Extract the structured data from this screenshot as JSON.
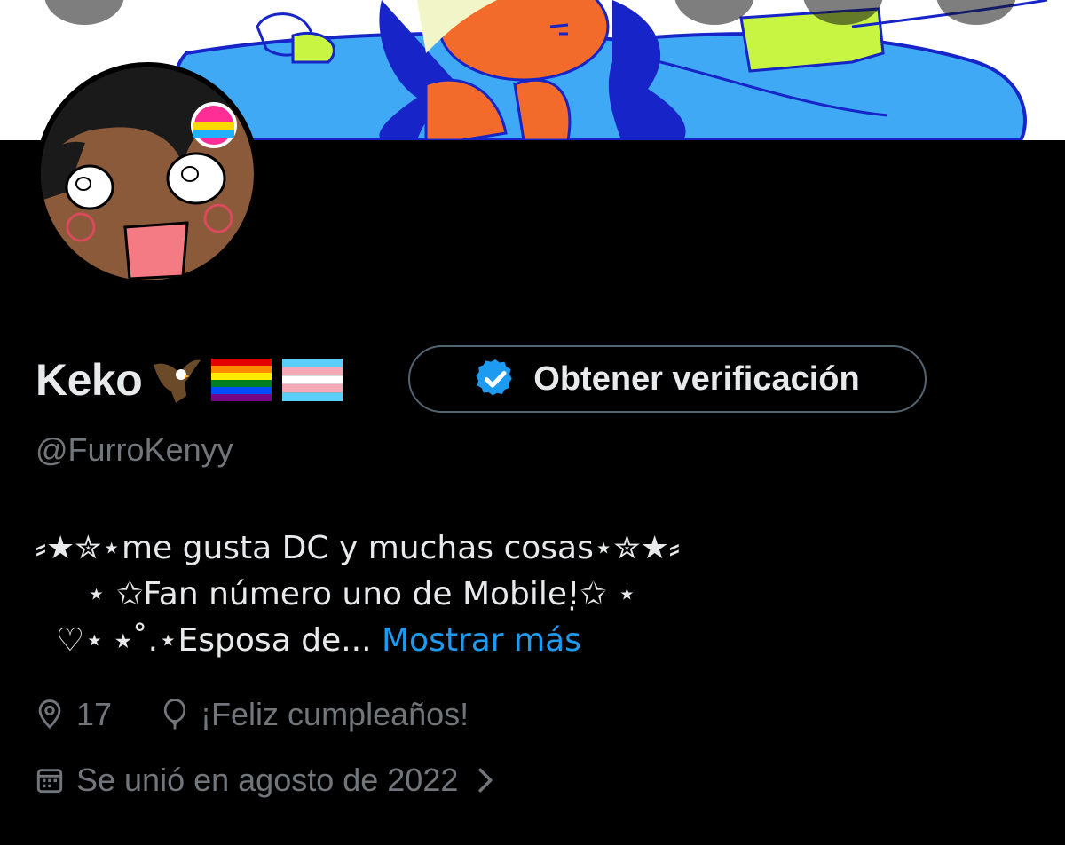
{
  "banner": {
    "background": "#ffffff",
    "colors": {
      "sky": "#3fa9f5",
      "ink": "#1624c8",
      "skin": "#f26b2a",
      "lime": "#c7f542"
    }
  },
  "profile": {
    "display_name": "Keko",
    "name_emojis": [
      "eagle",
      "rainbow-flag",
      "transgender-flag"
    ],
    "handle": "@FurroKenyy",
    "verify_button_label": "Obtener verificación",
    "verify_badge_color": "#1d9bf0"
  },
  "bio": {
    "lines": [
      "⸗★✮⋆me gusta DC y muchas cosas⋆✮★⸗",
      "     ⋆ ✩Fan número uno de Mobile!̣✩ ⋆",
      "  ♡⋆ ⭑˚.⋆Esposa de..."
    ],
    "show_more_label": "Mostrar más"
  },
  "meta": {
    "location": "17",
    "birthday": "¡Feliz cumpleaños!",
    "joined": "Se unió en agosto de 2022",
    "location_icon": "location-pin-icon",
    "birthday_icon": "balloon-icon",
    "joined_icon": "calendar-icon",
    "joined_chevron_icon": "chevron-right-icon"
  },
  "colors": {
    "background": "#000000",
    "text_primary": "#e7e9ea",
    "text_secondary": "#71767b",
    "link": "#1d9bf0"
  }
}
